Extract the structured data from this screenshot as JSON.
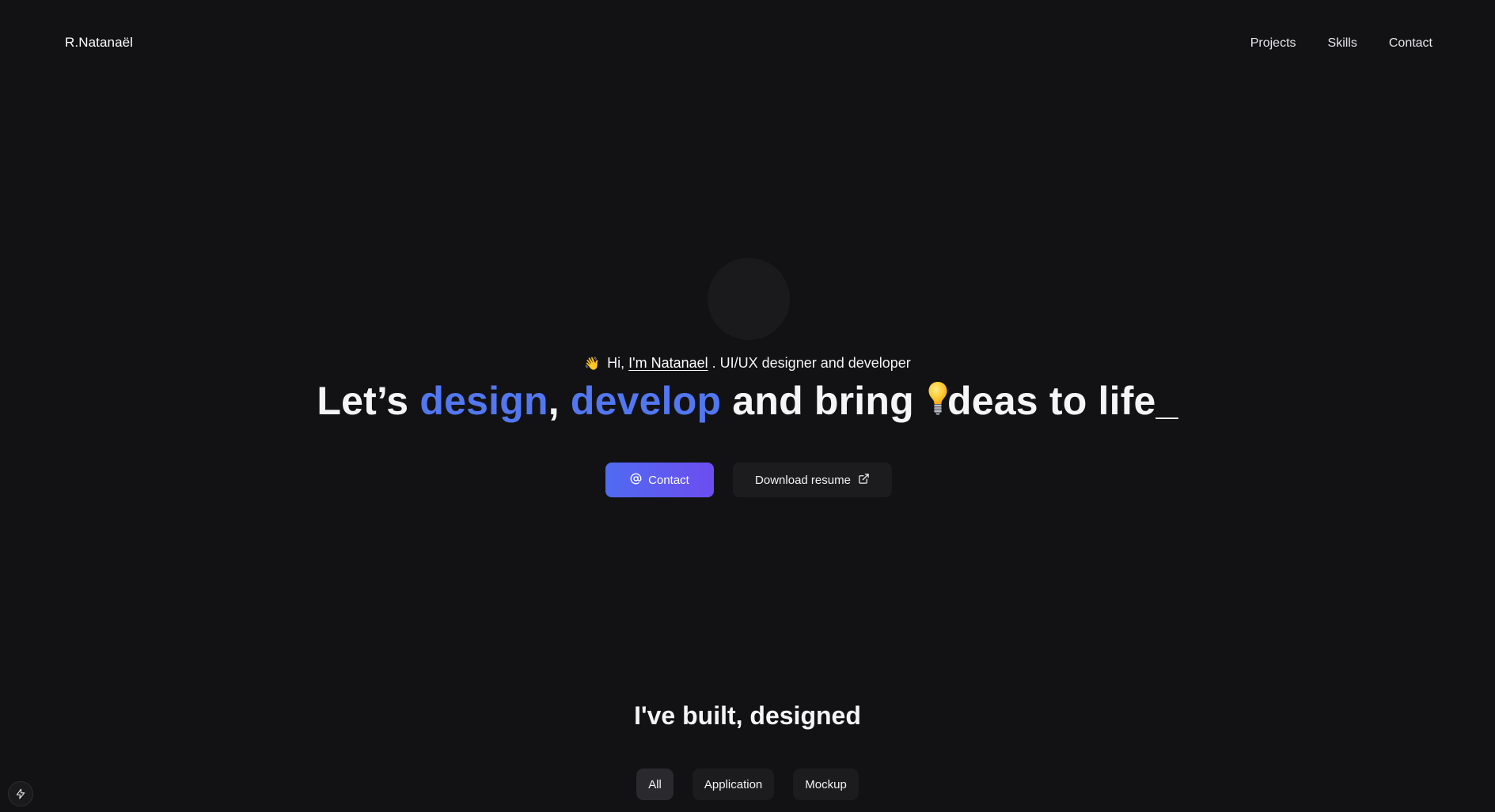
{
  "header": {
    "brand": "R.Natanaël",
    "nav": [
      "Projects",
      "Skills",
      "Contact"
    ]
  },
  "hero": {
    "intro_prefix": "Hi,",
    "intro_name": "I'm Natanael",
    "intro_suffix": ". UI/UX designer and developer",
    "headline": {
      "part1": "Let’s ",
      "accent1": "design",
      "part2": ", ",
      "accent2": "develop",
      "part3": " and bring ",
      "part4": "deas to life_"
    },
    "contact_button": "Contact",
    "resume_button": "Download resume"
  },
  "projects": {
    "title": "I've built, designed",
    "filters": [
      "All",
      "Application",
      "Mockup"
    ],
    "active_filter": "All"
  },
  "colors": {
    "background": "#121214",
    "accent_text": "#5277f0",
    "button_gradient_start": "#4f6bf1",
    "button_gradient_end": "#6d4df0"
  },
  "icons": [
    "wave-icon",
    "lightbulb-icon",
    "at-sign-icon",
    "external-link-icon",
    "lightning-icon"
  ]
}
